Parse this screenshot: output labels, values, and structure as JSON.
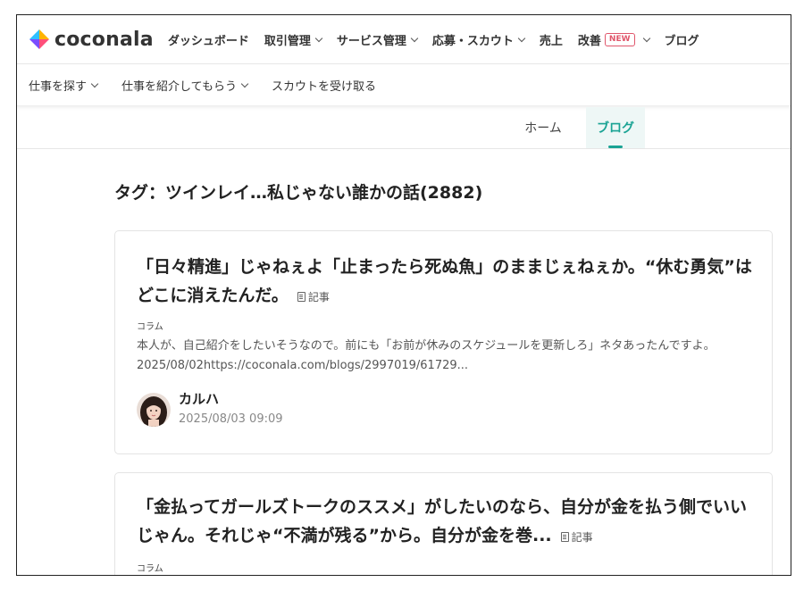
{
  "brand": {
    "name": "coconala"
  },
  "header": {
    "nav": [
      {
        "label": "ダッシュボード",
        "dropdown": false
      },
      {
        "label": "取引管理",
        "dropdown": true
      },
      {
        "label": "サービス管理",
        "dropdown": true
      },
      {
        "label": "応募・スカウト",
        "dropdown": true
      },
      {
        "label": "売上",
        "dropdown": false
      },
      {
        "label": "改善",
        "dropdown": true,
        "badge": "NEW"
      },
      {
        "label": "ブログ",
        "dropdown": false
      }
    ]
  },
  "subnav": {
    "items": [
      {
        "label": "仕事を探す"
      },
      {
        "label": "仕事を紹介してもらう"
      },
      {
        "label": "スカウトを受け取る"
      }
    ]
  },
  "tabs": {
    "home": "ホーム",
    "blog": "ブログ",
    "active": "blog"
  },
  "page": {
    "tag_title": "タグ：ツインレイ…私じゃない誰かの話(2882)"
  },
  "posts": [
    {
      "title": "「日々精進」じゃねぇよ「止まったら死ぬ魚」のままじぇねぇか。“休む勇気”はどこに消えたんだ。",
      "type": "記事",
      "category": "コラム",
      "excerpt": "本人が、自己紹介をしたいそうなので。前にも「お前が休みのスケジュールを更新しろ」ネタあったんですよ。2025/08/02https://coconala.com/blogs/2997019/61729...",
      "author": "カルハ",
      "date": "2025/08/03 09:09"
    },
    {
      "title": "「金払ってガールズトークのススメ」がしたいのなら、自分が金を払う側でいいじゃん。それじゃ“不満が残る”から。自分が金を巻...",
      "type": "記事",
      "category": "コラム"
    }
  ],
  "colors": {
    "accent": "#1aa394",
    "new_badge": "#e0566b",
    "text": "#222222",
    "muted": "#888888"
  }
}
